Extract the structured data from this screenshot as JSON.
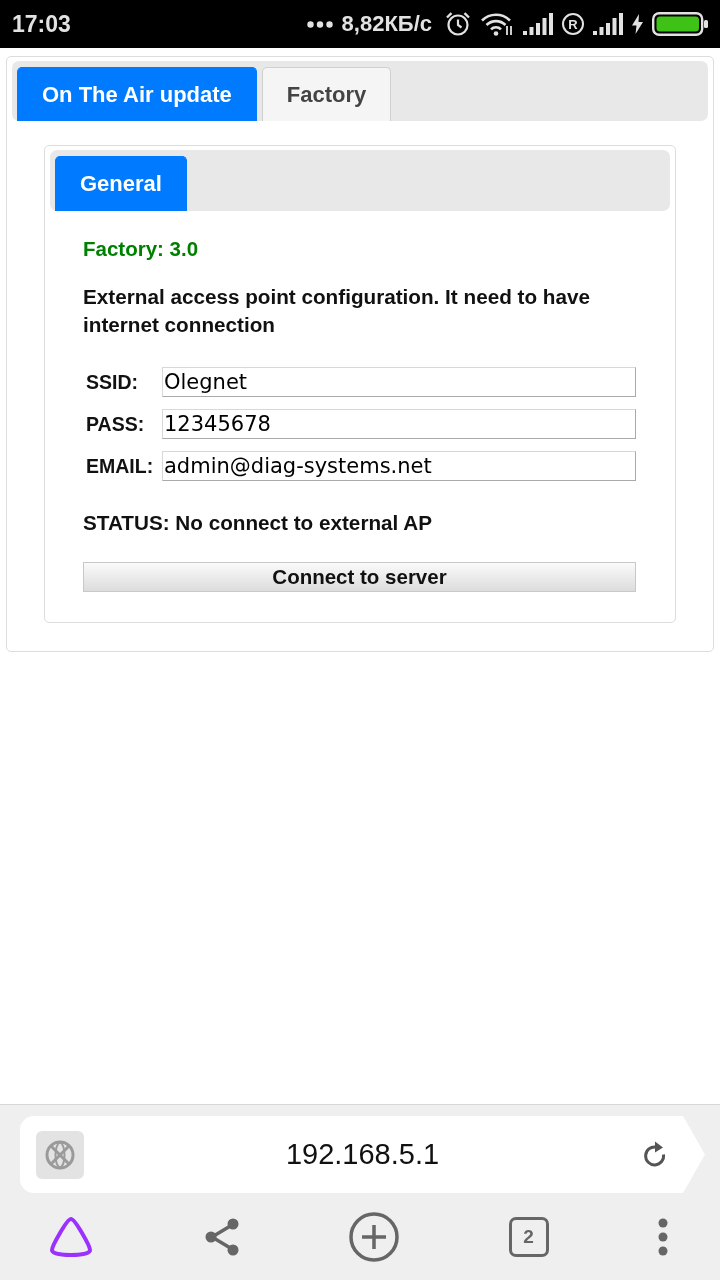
{
  "status_bar": {
    "time": "17:03",
    "network_speed": "8,82КБ/с",
    "roaming": "R"
  },
  "tabs": [
    {
      "label": "On The Air update",
      "selected": true
    },
    {
      "label": "Factory",
      "selected": false
    }
  ],
  "panel": {
    "tabs": [
      {
        "label": "General",
        "selected": true
      }
    ],
    "version": "Factory: 3.0",
    "description": "External access point configuration. It need to have internet connection",
    "fields": [
      {
        "label": "SSID:",
        "value": "Olegnet"
      },
      {
        "label": "PASS:",
        "value": "12345678"
      },
      {
        "label": "EMAIL:",
        "value": "admin@diag-systems.net"
      }
    ],
    "status": "STATUS: No connect to external AP",
    "button": "Connect to server"
  },
  "browser": {
    "url": "192.168.5.1",
    "tab_count": "2"
  }
}
